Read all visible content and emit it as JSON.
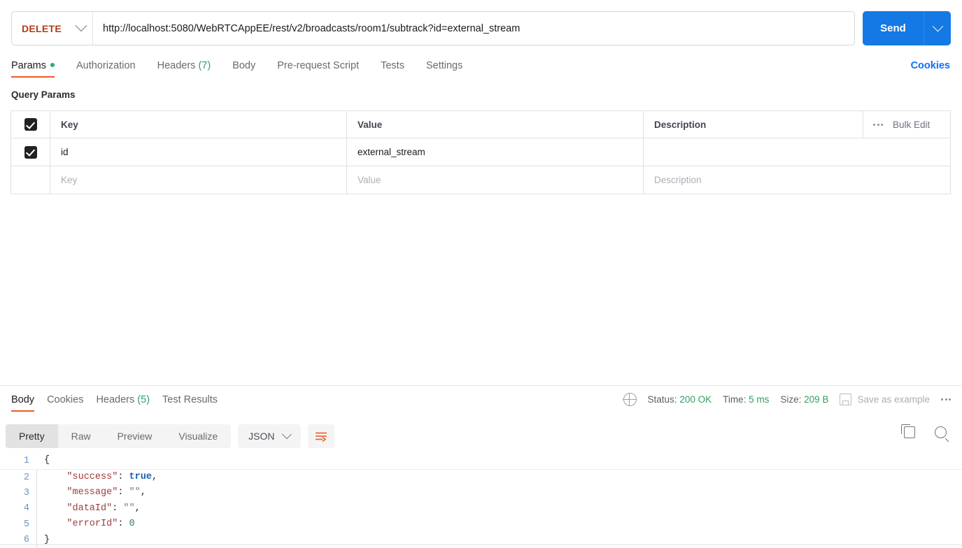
{
  "request": {
    "method": "DELETE",
    "method_caret_icon": "chevron-down-icon",
    "url": "http://localhost:5080/WebRTCAppEE/rest/v2/broadcasts/room1/subtrack?id=external_stream",
    "url_placeholder": "Enter request URL",
    "send_label": "Send",
    "send_caret_icon": "chevron-down-icon",
    "accent_orange": "#EF5B25",
    "send_blue": "#1479E4",
    "method_color": "#B23C17"
  },
  "request_tabs": [
    {
      "label": "Params",
      "badge_dot": true,
      "active": true
    },
    {
      "label": "Authorization",
      "active": false
    },
    {
      "label": "Headers",
      "count": "(7)",
      "active": false
    },
    {
      "label": "Body",
      "active": false
    },
    {
      "label": "Pre-request Script",
      "active": false
    },
    {
      "label": "Tests",
      "active": false
    },
    {
      "label": "Settings",
      "active": false
    }
  ],
  "cookies_link": "Cookies",
  "query_params": {
    "section_title": "Query Params",
    "headers": {
      "key": "Key",
      "value": "Value",
      "description": "Description",
      "more_icon": "more-horizontal-icon",
      "bulk_edit": "Bulk Edit"
    },
    "header_checkbox_checked": true,
    "rows": [
      {
        "checked": true,
        "key": "id",
        "value": "external_stream",
        "description": ""
      }
    ],
    "new_row": {
      "checked": false,
      "key_placeholder": "Key",
      "value_placeholder": "Value",
      "description_placeholder": "Description"
    }
  },
  "response": {
    "tabs": [
      {
        "label": "Body",
        "active": true
      },
      {
        "label": "Cookies",
        "active": false
      },
      {
        "label": "Headers",
        "count": "(5)",
        "active": false
      },
      {
        "label": "Test Results",
        "active": false
      }
    ],
    "meta": {
      "globe_icon": "globe-icon",
      "status_label": "Status:",
      "status_value": "200 OK",
      "time_label": "Time:",
      "time_value": "5 ms",
      "size_label": "Size:",
      "size_value": "209 B",
      "save_icon": "floppy-disk-icon",
      "save_label": "Save as example",
      "more_icon": "more-horizontal-icon",
      "green": "#2F9E5F"
    },
    "view_modes": [
      {
        "label": "Pretty",
        "active": true
      },
      {
        "label": "Raw",
        "active": false
      },
      {
        "label": "Preview",
        "active": false
      },
      {
        "label": "Visualize",
        "active": false
      }
    ],
    "language": "JSON",
    "language_caret_icon": "chevron-down-icon",
    "wrap_icon": "word-wrap-icon",
    "copy_icon": "copy-icon",
    "search_icon": "search-icon",
    "body_lines": [
      {
        "num": "1",
        "segments": [
          {
            "t": "{",
            "c": "punc"
          }
        ]
      },
      {
        "num": "2",
        "segments": [
          {
            "t": "    ",
            "c": "punc"
          },
          {
            "t": "\"success\"",
            "c": "k"
          },
          {
            "t": ": ",
            "c": "punc"
          },
          {
            "t": "true",
            "c": "bool"
          },
          {
            "t": ",",
            "c": "punc"
          }
        ]
      },
      {
        "num": "3",
        "segments": [
          {
            "t": "    ",
            "c": "punc"
          },
          {
            "t": "\"message\"",
            "c": "k"
          },
          {
            "t": ": ",
            "c": "punc"
          },
          {
            "t": "\"\"",
            "c": "str"
          },
          {
            "t": ",",
            "c": "punc"
          }
        ]
      },
      {
        "num": "4",
        "segments": [
          {
            "t": "    ",
            "c": "punc"
          },
          {
            "t": "\"dataId\"",
            "c": "k"
          },
          {
            "t": ": ",
            "c": "punc"
          },
          {
            "t": "\"\"",
            "c": "str"
          },
          {
            "t": ",",
            "c": "punc"
          }
        ]
      },
      {
        "num": "5",
        "segments": [
          {
            "t": "    ",
            "c": "punc"
          },
          {
            "t": "\"errorId\"",
            "c": "k"
          },
          {
            "t": ": ",
            "c": "punc"
          },
          {
            "t": "0",
            "c": "num"
          }
        ]
      },
      {
        "num": "6",
        "segments": [
          {
            "t": "}",
            "c": "punc"
          }
        ]
      }
    ]
  }
}
